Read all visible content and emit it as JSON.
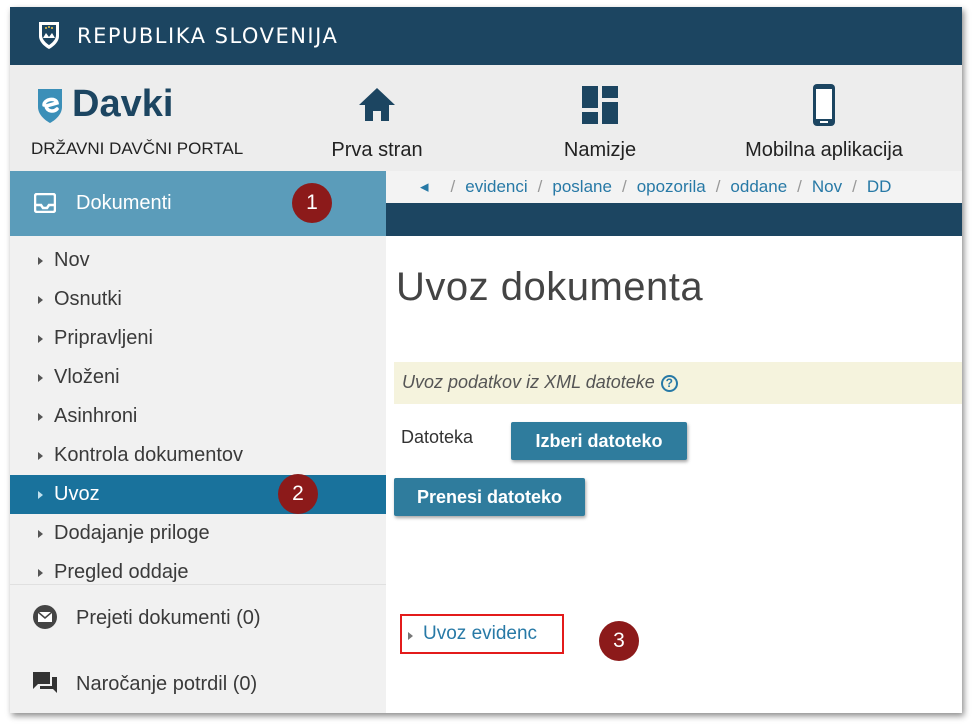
{
  "gov_bar": {
    "title": "REPUBLIKA SLOVENIJA"
  },
  "header": {
    "brand_name": "Davki",
    "brand_subtitle": "DRŽAVNI DAVČNI PORTAL",
    "nav": [
      {
        "label": "Prva stran",
        "icon": "home-icon"
      },
      {
        "label": "Namizje",
        "icon": "dashboard-icon"
      },
      {
        "label": "Mobilna aplikacija",
        "icon": "mobile-icon"
      }
    ]
  },
  "sidebar": {
    "active_section": {
      "label": "Dokumenti",
      "icon": "inbox-icon"
    },
    "items": [
      {
        "label": "Nov"
      },
      {
        "label": "Osnutki"
      },
      {
        "label": "Pripravljeni"
      },
      {
        "label": "Vloženi"
      },
      {
        "label": "Asinhroni"
      },
      {
        "label": "Kontrola dokumentov"
      },
      {
        "label": "Uvoz",
        "active": true
      },
      {
        "label": "Dodajanje priloge"
      },
      {
        "label": "Pregled oddaje"
      }
    ],
    "groups": [
      {
        "label": "Prejeti dokumenti (0)",
        "icon": "mail-icon"
      },
      {
        "label": "Naročanje potrdil (0)",
        "icon": "chat-icon"
      }
    ]
  },
  "breadcrumb": [
    "evidenci",
    "poslane",
    "opozorila",
    "oddane",
    "Nov",
    "DD"
  ],
  "main": {
    "title": "Uvoz dokumenta",
    "info": "Uvoz podatkov iz XML datoteke",
    "file_label": "Datoteka",
    "choose_button": "Izberi datoteko",
    "upload_button": "Prenesi datoteko",
    "evidence_link": "Uvoz evidenc"
  },
  "annotations": {
    "one": "1",
    "two": "2",
    "three": "3"
  },
  "colors": {
    "gov_bar": "#1c4561",
    "sidebar_active": "#5b9cba",
    "item_active": "#19729c",
    "button": "#2f7c9d",
    "badge": "#8c1a1a",
    "highlight_border": "#e31b1b"
  }
}
